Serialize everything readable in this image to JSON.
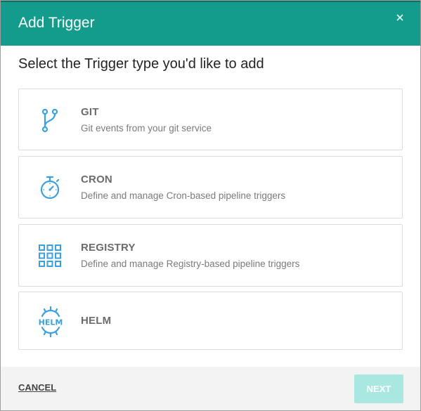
{
  "dialog": {
    "title": "Add Trigger",
    "close_glyph": "×"
  },
  "subtitle": "Select the Trigger type you'd like to add",
  "trigger_types": [
    {
      "name": "GIT",
      "description": "Git events from your git service",
      "icon": "git-branch-icon"
    },
    {
      "name": "CRON",
      "description": "Define and manage Cron-based pipeline triggers",
      "icon": "stopwatch-icon"
    },
    {
      "name": "REGISTRY",
      "description": "Define and manage Registry-based pipeline triggers",
      "icon": "grid-icon"
    },
    {
      "name": "HELM",
      "description": "",
      "icon": "helm-icon",
      "icon_text": "HELM"
    }
  ],
  "footer": {
    "cancel_label": "CANCEL",
    "next_label": "NEXT",
    "next_enabled": false
  },
  "colors": {
    "header": "#139c8c",
    "icon": "#3aa1dc",
    "next_disabled": "#a9e8e1"
  }
}
